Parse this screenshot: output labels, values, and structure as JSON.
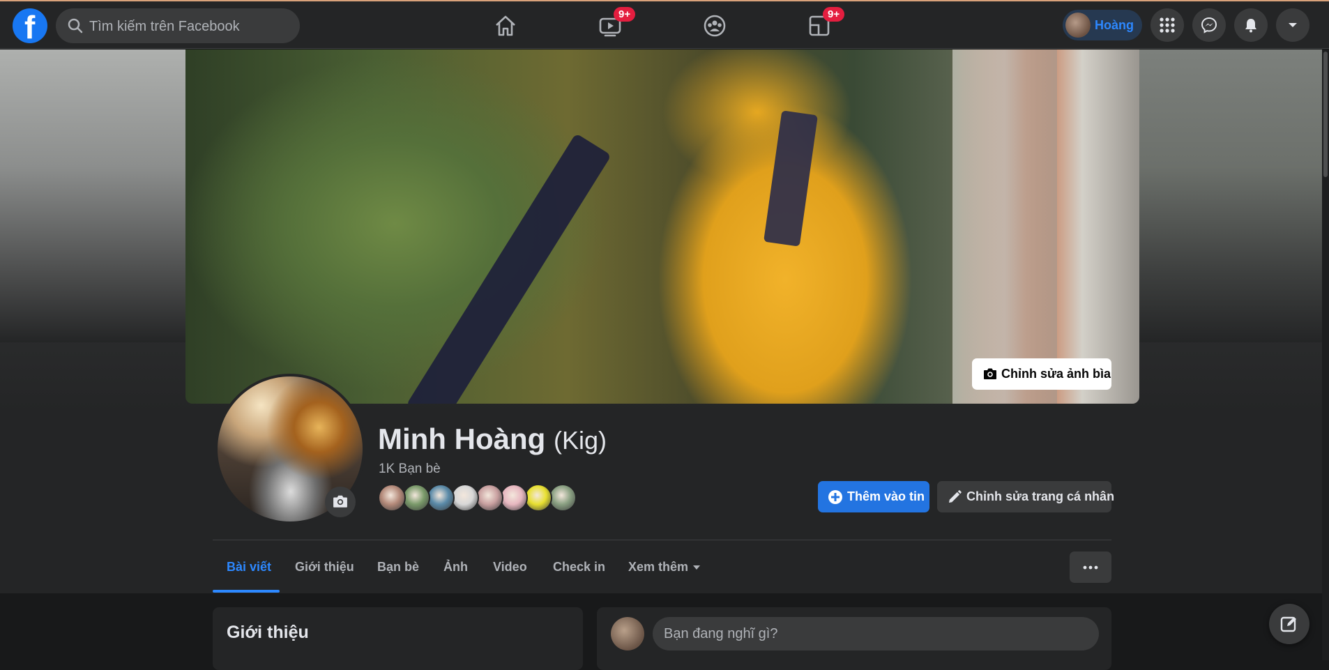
{
  "topnav": {
    "logo_letter": "f",
    "search_placeholder": "Tìm kiếm trên Facebook",
    "tabs": [
      {
        "name": "home",
        "icon": "home-icon"
      },
      {
        "name": "watch",
        "icon": "watch-icon",
        "badge": "9+"
      },
      {
        "name": "groups",
        "icon": "groups-icon"
      },
      {
        "name": "gaming",
        "icon": "gaming-icon",
        "badge": "9+"
      }
    ],
    "profile_name": "Hoàng",
    "right_icons": [
      "menu-grid-icon",
      "messenger-icon",
      "notifications-icon",
      "account-dropdown-icon"
    ]
  },
  "profile": {
    "edit_cover_label": "Chỉnh sửa ảnh bìa",
    "name": "Minh Hoàng",
    "nickname": "(Kig)",
    "friend_count": "1K Bạn bè",
    "friend_avatar_colors": [
      "#b48a7a",
      "#7a9a6a",
      "#5a8aa8",
      "#d8d8d8",
      "#c9a0a0",
      "#e7b7c0",
      "#e8e030",
      "#8aa082"
    ],
    "add_story_label": "Thêm vào tin",
    "edit_profile_label": "Chỉnh sửa trang cá nhân"
  },
  "tabs": [
    {
      "label": "Bài viết",
      "active": true
    },
    {
      "label": "Giới thiệu"
    },
    {
      "label": "Bạn bè"
    },
    {
      "label": "Ảnh"
    },
    {
      "label": "Video"
    },
    {
      "label": "Check in"
    },
    {
      "label": "Xem thêm"
    }
  ],
  "intro": {
    "title": "Giới thiệu"
  },
  "composer": {
    "placeholder": "Bạn đang nghĩ gì?"
  },
  "colors": {
    "background": "#18191a",
    "surface": "#242526",
    "accent": "#2d88ff",
    "primary_button": "#2374e1",
    "badge": "#e41e3f"
  }
}
